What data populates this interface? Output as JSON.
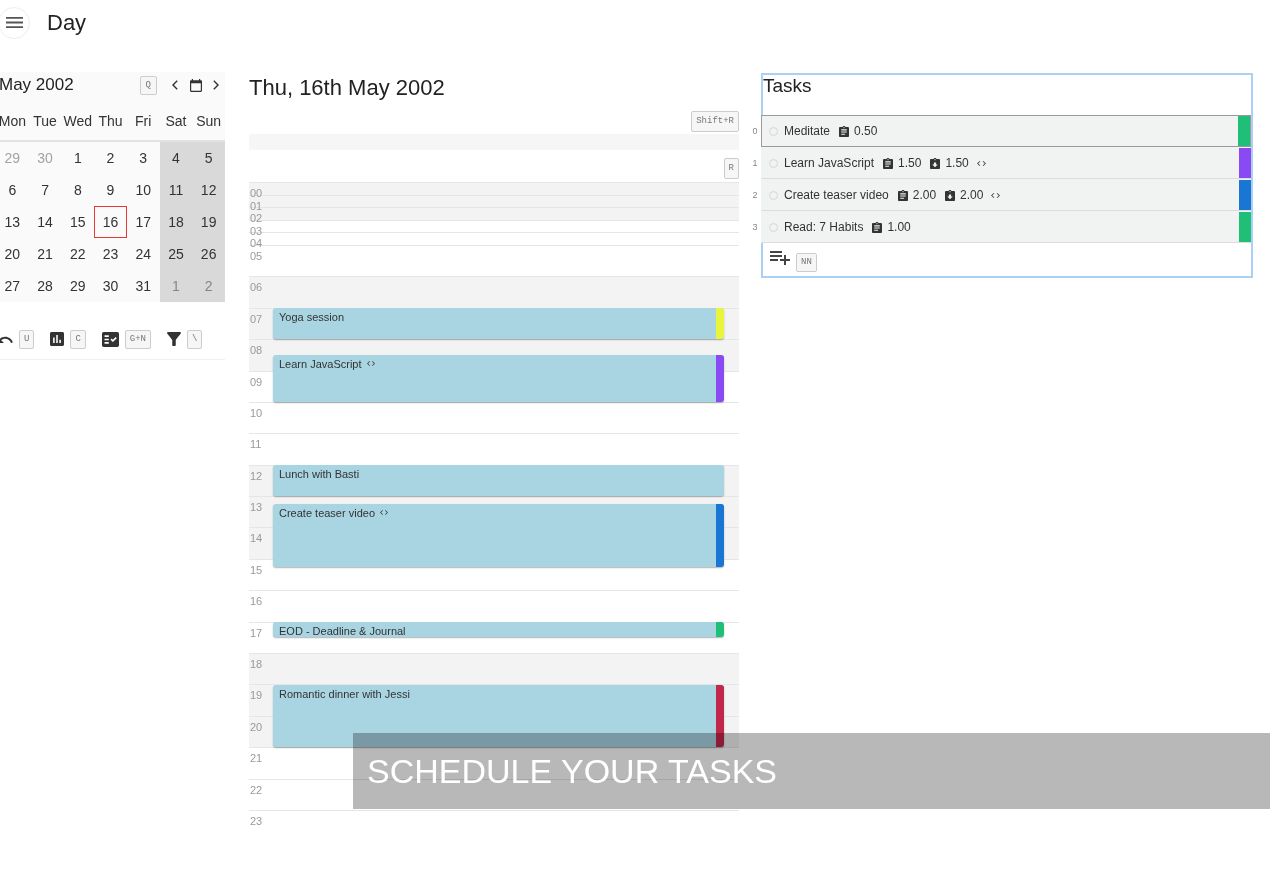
{
  "header": {
    "title": "Day"
  },
  "mini_calendar": {
    "month": "May 2002",
    "shortcut": "Q",
    "weekdays": [
      {
        "label": "Mon",
        "weekend": false
      },
      {
        "label": "Tue",
        "weekend": false
      },
      {
        "label": "Wed",
        "weekend": false
      },
      {
        "label": "Thu",
        "weekend": false
      },
      {
        "label": "Fri",
        "weekend": false
      },
      {
        "label": "Sat",
        "weekend": true
      },
      {
        "label": "Sun",
        "weekend": true
      }
    ],
    "weeks": [
      [
        {
          "day": "29",
          "outside": true,
          "selected": false
        },
        {
          "day": "30",
          "outside": true,
          "selected": false
        },
        {
          "day": "1",
          "outside": false,
          "selected": false
        },
        {
          "day": "2",
          "outside": false,
          "selected": false
        },
        {
          "day": "3",
          "outside": false,
          "selected": false
        },
        {
          "day": "4",
          "outside": false,
          "selected": false
        },
        {
          "day": "5",
          "outside": false,
          "selected": false
        }
      ],
      [
        {
          "day": "6",
          "outside": false,
          "selected": false
        },
        {
          "day": "7",
          "outside": false,
          "selected": false
        },
        {
          "day": "8",
          "outside": false,
          "selected": false
        },
        {
          "day": "9",
          "outside": false,
          "selected": false
        },
        {
          "day": "10",
          "outside": false,
          "selected": false
        },
        {
          "day": "11",
          "outside": false,
          "selected": false
        },
        {
          "day": "12",
          "outside": false,
          "selected": false
        }
      ],
      [
        {
          "day": "13",
          "outside": false,
          "selected": false
        },
        {
          "day": "14",
          "outside": false,
          "selected": false
        },
        {
          "day": "15",
          "outside": false,
          "selected": false
        },
        {
          "day": "16",
          "outside": false,
          "selected": true
        },
        {
          "day": "17",
          "outside": false,
          "selected": false
        },
        {
          "day": "18",
          "outside": false,
          "selected": false
        },
        {
          "day": "19",
          "outside": false,
          "selected": false
        }
      ],
      [
        {
          "day": "20",
          "outside": false,
          "selected": false
        },
        {
          "day": "21",
          "outside": false,
          "selected": false
        },
        {
          "day": "22",
          "outside": false,
          "selected": false
        },
        {
          "day": "23",
          "outside": false,
          "selected": false
        },
        {
          "day": "24",
          "outside": false,
          "selected": false
        },
        {
          "day": "25",
          "outside": false,
          "selected": false
        },
        {
          "day": "26",
          "outside": false,
          "selected": false
        }
      ],
      [
        {
          "day": "27",
          "outside": false,
          "selected": false
        },
        {
          "day": "28",
          "outside": false,
          "selected": false
        },
        {
          "day": "29",
          "outside": false,
          "selected": false
        },
        {
          "day": "30",
          "outside": false,
          "selected": false
        },
        {
          "day": "31",
          "outside": false,
          "selected": false
        },
        {
          "day": "1",
          "outside": true,
          "selected": false
        },
        {
          "day": "2",
          "outside": true,
          "selected": false
        }
      ]
    ]
  },
  "toolbar": [
    {
      "shortcut": "U"
    },
    {
      "shortcut": "C"
    },
    {
      "shortcut": "G+N"
    },
    {
      "shortcut": "\\"
    }
  ],
  "day_view": {
    "title": "Thu, 16th May 2002",
    "shortcuts": [
      "Shift+R",
      "R"
    ],
    "hours": [
      {
        "label": "00",
        "collapsed": true
      },
      {
        "label": "01",
        "collapsed": true
      },
      {
        "label": "02",
        "collapsed": true
      },
      {
        "label": "03",
        "collapsed": true
      },
      {
        "label": "04",
        "collapsed": true
      },
      {
        "label": "05",
        "collapsed": false
      },
      {
        "label": "06",
        "collapsed": false
      },
      {
        "label": "07",
        "collapsed": false
      },
      {
        "label": "08",
        "collapsed": false
      },
      {
        "label": "09",
        "collapsed": false
      },
      {
        "label": "10",
        "collapsed": false
      },
      {
        "label": "11",
        "collapsed": false
      },
      {
        "label": "12",
        "collapsed": false
      },
      {
        "label": "13",
        "collapsed": false
      },
      {
        "label": "14",
        "collapsed": false
      },
      {
        "label": "15",
        "collapsed": false
      },
      {
        "label": "16",
        "collapsed": false
      },
      {
        "label": "17",
        "collapsed": false
      },
      {
        "label": "18",
        "collapsed": false
      },
      {
        "label": "19",
        "collapsed": false
      },
      {
        "label": "20",
        "collapsed": false
      },
      {
        "label": "21",
        "collapsed": false
      },
      {
        "label": "22",
        "collapsed": false
      },
      {
        "label": "23",
        "collapsed": false
      }
    ],
    "events": [
      {
        "title": "Yoga session",
        "code_icon": false,
        "color": "#e8f53c"
      },
      {
        "title": "Learn JavaScript",
        "code_icon": true,
        "color": "#8a4af3"
      },
      {
        "title": "Lunch with Basti",
        "code_icon": false
      },
      {
        "title": "Create teaser video",
        "code_icon": true,
        "color": "#1976d2"
      },
      {
        "title": "EOD - Deadline & Journal",
        "code_icon": false,
        "color": "#1fbf78"
      },
      {
        "title": "Romantic dinner with Jessi",
        "code_icon": false,
        "color": "#c2264b"
      }
    ]
  },
  "tasks": {
    "title": "Tasks",
    "items": [
      {
        "index": "0",
        "name": "Meditate",
        "done": false,
        "focused": true,
        "figures": [
          "0.50"
        ],
        "code_icon": false,
        "color": "#1fbf78"
      },
      {
        "index": "1",
        "name": "Learn JavaScript",
        "done": false,
        "focused": false,
        "figures": [
          "1.50",
          "1.50"
        ],
        "code_icon": true,
        "color": "#8a4af3"
      },
      {
        "index": "2",
        "name": "Create teaser video",
        "done": false,
        "focused": false,
        "figures": [
          "2.00",
          "2.00"
        ],
        "code_icon": true,
        "color": "#1976d2"
      },
      {
        "index": "3",
        "name": "Read: 7 Habits",
        "done": false,
        "focused": false,
        "figures": [
          "1.00"
        ],
        "code_icon": false,
        "color": "#1fbf78"
      }
    ],
    "footer_shortcut": "NN"
  },
  "caption": "SCHEDULE YOUR TASKS"
}
